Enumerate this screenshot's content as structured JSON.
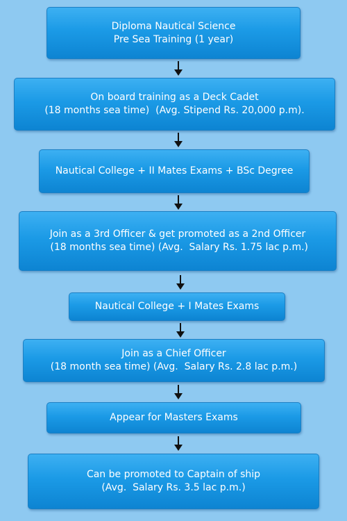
{
  "flow": {
    "steps": [
      {
        "line1": "Diploma Nautical Science",
        "line2": "Pre Sea Training (1 year)"
      },
      {
        "line1": "On board training as a Deck Cadet",
        "line2": "(18 months sea time)  (Avg. Stipend Rs. 20,000 p.m)."
      },
      {
        "line1": "Nautical College + II Mates Exams + BSc Degree"
      },
      {
        "line1": "Join as a 3rd Officer & get promoted as a 2nd Officer",
        "line2": " (18 months sea time) (Avg.  Salary Rs. 1.75 lac p.m.)"
      },
      {
        "line1": "Nautical College + I Mates Exams"
      },
      {
        "line1": "Join as a Chief Officer",
        "line2": "(18 month sea time) (Avg.  Salary Rs. 2.8 lac p.m.)"
      },
      {
        "line1": "Appear for Masters Exams"
      },
      {
        "line1": "Can be promoted to Captain of ship",
        "line2": "(Avg.  Salary Rs. 3.5 lac p.m.)"
      }
    ],
    "colors": {
      "background": "#8ec9f1",
      "box": "#1b9ae6",
      "text": "#ffffff",
      "arrow": "#111111"
    }
  }
}
